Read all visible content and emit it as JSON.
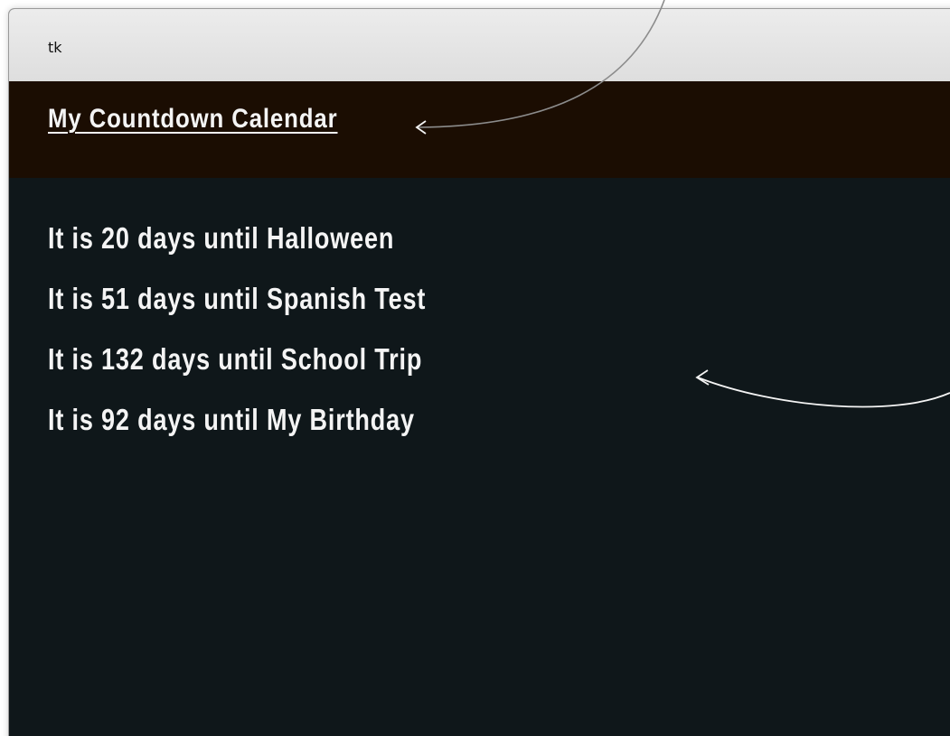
{
  "window": {
    "title": "tk"
  },
  "heading": "My Countdown Calendar",
  "countdowns": [
    "It is 20 days until Halloween",
    "It is 51 days until Spanish Test",
    "It is 132 days until School Trip",
    "It is 92 days until My Birthday"
  ],
  "colors": {
    "titlebar": "#e4e4e4",
    "header_band": "#1b0d02",
    "canvas": "#0f171a",
    "text": "#f4f4f4"
  }
}
